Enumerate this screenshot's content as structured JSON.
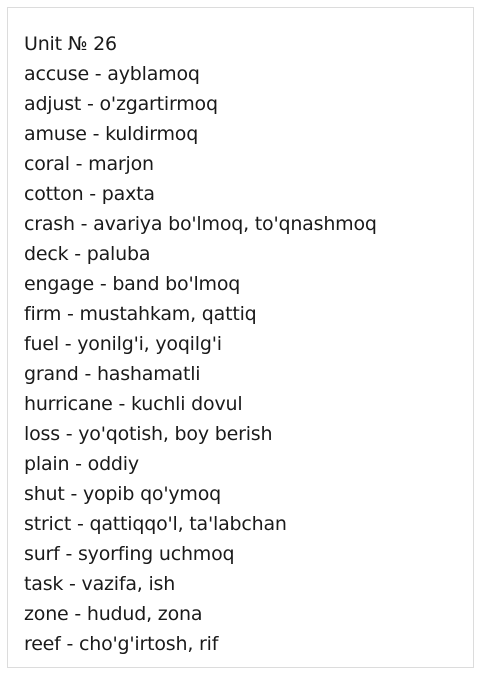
{
  "title": "Unit № 26",
  "entries": [
    "accuse - ayblamoq",
    "adjust - o'zgartirmoq",
    "amuse - kuldirmoq",
    "coral - marjon",
    "cotton - paxta",
    "crash - avariya bo'lmoq, to'qnashmoq",
    "deck - paluba",
    "engage - band bo'lmoq",
    "firm - mustahkam, qattiq",
    "fuel - yonilg'i, yoqilg'i",
    "grand - hashamatli",
    "hurricane - kuchli dovul",
    "loss - yo'qotish, boy berish",
    "plain - oddiy",
    "shut - yopib qo'ymoq",
    "strict - qattiqqo'l, ta'labchan",
    "surf - syorfing uchmoq",
    "task - vazifa, ish",
    "zone - hudud, zona",
    "reef - cho'g'irtosh, rif"
  ]
}
